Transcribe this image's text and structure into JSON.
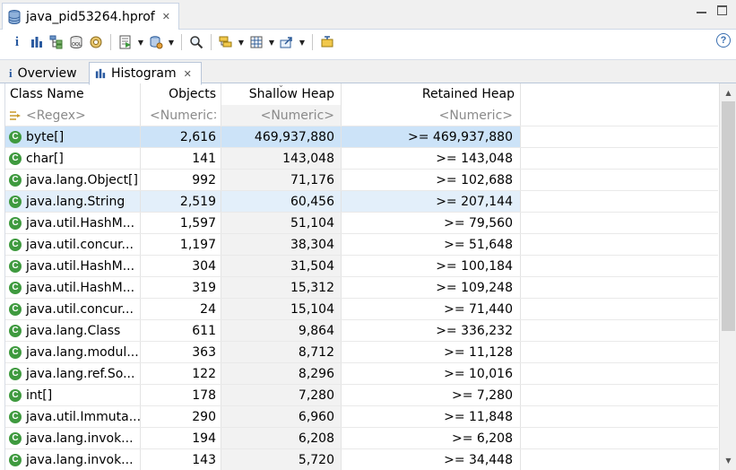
{
  "editor": {
    "tab_title": "java_pid53264.hprof"
  },
  "toolbar": {
    "buttons": [
      "info-icon",
      "histogram-icon",
      "dominator-tree-icon",
      "oql-icon",
      "thread-overview-icon",
      "run-report-icon",
      "query-browser-icon",
      "find-object-icon",
      "group-by-icon",
      "calculate-retained-icon",
      "export-icon",
      "pin-icon",
      "help-icon"
    ]
  },
  "tabs": [
    {
      "label": "Overview"
    },
    {
      "label": "Histogram"
    }
  ],
  "table": {
    "columns": [
      "Class Name",
      "Objects",
      "Shallow Heap",
      "Retained Heap"
    ],
    "filter": {
      "class_name": "<Regex>",
      "objects": "<Numeric>",
      "shallow": "<Numeric>",
      "retained": "<Numeric>"
    },
    "rows": [
      {
        "name": "byte[]",
        "objects": "2,616",
        "shallow": "469,937,880",
        "retained": ">= 469,937,880"
      },
      {
        "name": "char[]",
        "objects": "141",
        "shallow": "143,048",
        "retained": ">= 143,048"
      },
      {
        "name": "java.lang.Object[]",
        "objects": "992",
        "shallow": "71,176",
        "retained": ">= 102,688"
      },
      {
        "name": "java.lang.String",
        "objects": "2,519",
        "shallow": "60,456",
        "retained": ">= 207,144"
      },
      {
        "name": "java.util.HashM...",
        "objects": "1,597",
        "shallow": "51,104",
        "retained": ">= 79,560"
      },
      {
        "name": "java.util.concur...",
        "objects": "1,197",
        "shallow": "38,304",
        "retained": ">= 51,648"
      },
      {
        "name": "java.util.HashM...",
        "objects": "304",
        "shallow": "31,504",
        "retained": ">= 100,184"
      },
      {
        "name": "java.util.HashM...",
        "objects": "319",
        "shallow": "15,312",
        "retained": ">= 109,248"
      },
      {
        "name": "java.util.concur...",
        "objects": "24",
        "shallow": "15,104",
        "retained": ">= 71,440"
      },
      {
        "name": "java.lang.Class",
        "objects": "611",
        "shallow": "9,864",
        "retained": ">= 336,232"
      },
      {
        "name": "java.lang.modul...",
        "objects": "363",
        "shallow": "8,712",
        "retained": ">= 11,128"
      },
      {
        "name": "java.lang.ref.So...",
        "objects": "122",
        "shallow": "8,296",
        "retained": ">= 10,016"
      },
      {
        "name": "int[]",
        "objects": "178",
        "shallow": "7,280",
        "retained": ">= 7,280"
      },
      {
        "name": "java.util.Immuta...",
        "objects": "290",
        "shallow": "6,960",
        "retained": ">= 11,848"
      },
      {
        "name": "java.lang.invok...",
        "objects": "194",
        "shallow": "6,208",
        "retained": ">= 6,208"
      },
      {
        "name": "java.lang.invok...",
        "objects": "143",
        "shallow": "5,720",
        "retained": ">= 34,448"
      }
    ]
  }
}
